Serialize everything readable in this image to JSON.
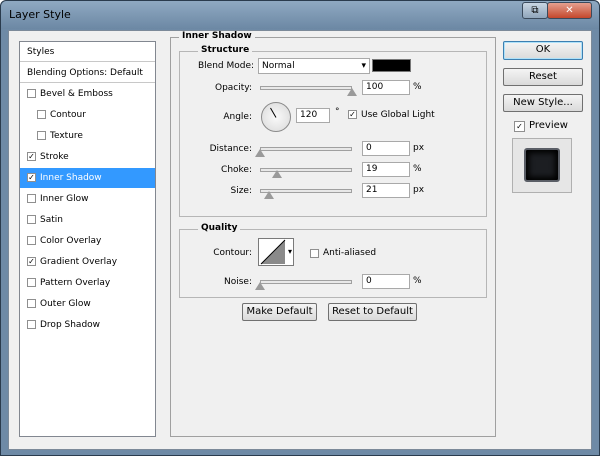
{
  "window": {
    "title": "Layer Style",
    "restore_glyph": "⧉",
    "close_glyph": "✕"
  },
  "styles_list": {
    "header": "Styles",
    "blending": "Blending Options: Default",
    "items": [
      {
        "label": "Bevel & Emboss",
        "checked": false,
        "selected": false
      },
      {
        "label": "Contour",
        "checked": false,
        "selected": false
      },
      {
        "label": "Texture",
        "checked": false,
        "selected": false
      },
      {
        "label": "Stroke",
        "checked": true,
        "selected": false
      },
      {
        "label": "Inner Shadow",
        "checked": true,
        "selected": true
      },
      {
        "label": "Inner Glow",
        "checked": false,
        "selected": false
      },
      {
        "label": "Satin",
        "checked": false,
        "selected": false
      },
      {
        "label": "Color Overlay",
        "checked": false,
        "selected": false
      },
      {
        "label": "Gradient Overlay",
        "checked": true,
        "selected": false
      },
      {
        "label": "Pattern Overlay",
        "checked": false,
        "selected": false
      },
      {
        "label": "Outer Glow",
        "checked": false,
        "selected": false
      },
      {
        "label": "Drop Shadow",
        "checked": false,
        "selected": false
      }
    ]
  },
  "inner_shadow": {
    "title": "Inner Shadow",
    "structure_title": "Structure",
    "blend_mode_label": "Blend Mode:",
    "blend_mode_value": "Normal",
    "shadow_color": "#000000",
    "opacity_label": "Opacity:",
    "opacity_value": "100",
    "opacity_unit": "%",
    "opacity_fraction": 1.0,
    "angle_label": "Angle:",
    "angle_value": "120",
    "angle_unit": "°",
    "use_global_light_label": "Use Global Light",
    "use_global_light": true,
    "distance_label": "Distance:",
    "distance_value": "0",
    "distance_unit": "px",
    "distance_fraction": 0.0,
    "choke_label": "Choke:",
    "choke_value": "19",
    "choke_unit": "%",
    "choke_fraction": 0.19,
    "size_label": "Size:",
    "size_value": "21",
    "size_unit": "px",
    "size_fraction": 0.1
  },
  "quality": {
    "title": "Quality",
    "contour_label": "Contour:",
    "anti_aliased_label": "Anti-aliased",
    "anti_aliased": false,
    "noise_label": "Noise:",
    "noise_value": "0",
    "noise_unit": "%",
    "noise_fraction": 0.0
  },
  "buttons": {
    "make_default": "Make Default",
    "reset_to_default": "Reset to Default",
    "ok": "OK",
    "reset": "Reset",
    "new_style": "New Style...",
    "preview_label": "Preview",
    "preview_checked": true
  },
  "colors": {
    "selection": "#3399ff",
    "title_bar": "#6c88a4",
    "close_button": "#c4472c"
  }
}
